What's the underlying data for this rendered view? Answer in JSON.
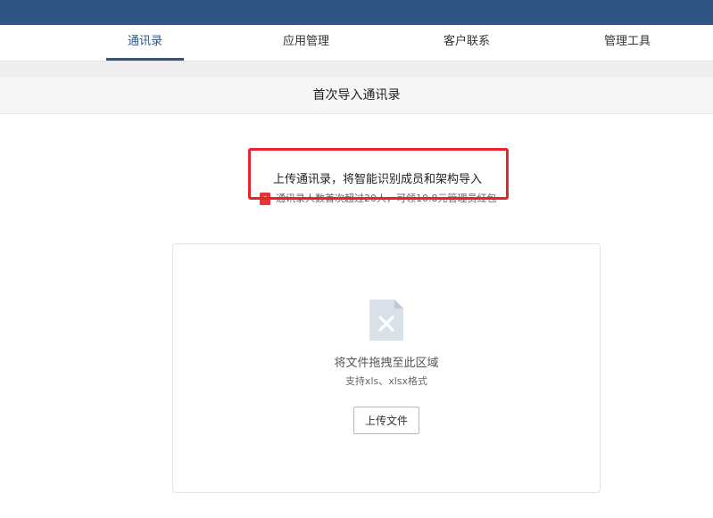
{
  "colors": {
    "brand": "#2f5584",
    "highlight": "#e8232c",
    "promo": "#e8353a"
  },
  "nav": {
    "tabs": [
      {
        "label": "通讯录",
        "active": true
      },
      {
        "label": "应用管理",
        "active": false
      },
      {
        "label": "客户联系",
        "active": false
      },
      {
        "label": "管理工具",
        "active": false
      }
    ]
  },
  "page": {
    "title": "首次导入通讯录"
  },
  "intro": {
    "text": "上传通讯录，将智能识别成员和架构导入",
    "promo_icon": "red-envelope-icon",
    "promo_text": "通讯录人数首次超过20人，可领10.8元管理员红包"
  },
  "upload": {
    "file_icon": "excel-file-icon",
    "drop_hint": "将文件拖拽至此区域",
    "format_hint": "支持xls、xlsx格式",
    "button_label": "上传文件"
  }
}
